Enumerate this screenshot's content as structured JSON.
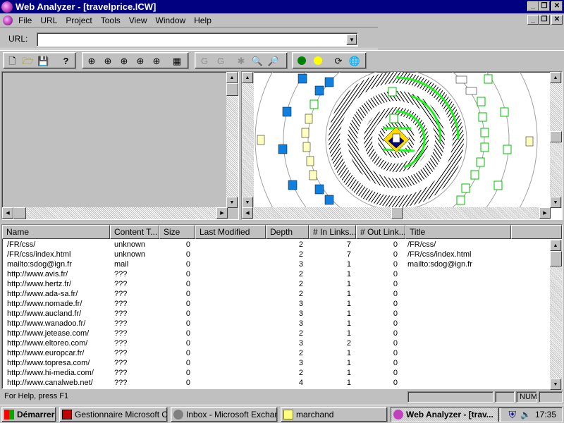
{
  "window": {
    "title": "Web Analyzer - [travelprice.ICW]"
  },
  "menu": [
    "File",
    "URL",
    "Project",
    "Tools",
    "View",
    "Window",
    "Help"
  ],
  "urlbar": {
    "label": "URL:",
    "value": ""
  },
  "list": {
    "columns": [
      "Name",
      "Content T...",
      "Size",
      "Last Modified",
      "Depth",
      "# In Links...",
      "# Out Link...",
      "Title"
    ],
    "rows": [
      [
        "/FR/css/",
        "unknown",
        "0",
        "",
        "2",
        "7",
        "0",
        "/FR/css/"
      ],
      [
        "/FR/css/index.html",
        "unknown",
        "0",
        "",
        "2",
        "7",
        "0",
        "/FR/css/index.html"
      ],
      [
        "mailto:sdog@ign.fr",
        "mail",
        "0",
        "",
        "3",
        "1",
        "0",
        "mailto:sdog@ign.fr"
      ],
      [
        "http://www.avis.fr/",
        "???",
        "0",
        "",
        "2",
        "1",
        "0",
        ""
      ],
      [
        "http://www.hertz.fr/",
        "???",
        "0",
        "",
        "2",
        "1",
        "0",
        ""
      ],
      [
        "http://www.ada-sa.fr/",
        "???",
        "0",
        "",
        "2",
        "1",
        "0",
        ""
      ],
      [
        "http://www.nomade.fr/",
        "???",
        "0",
        "",
        "3",
        "1",
        "0",
        ""
      ],
      [
        "http://www.aucland.fr/",
        "???",
        "0",
        "",
        "3",
        "1",
        "0",
        ""
      ],
      [
        "http://www.wanadoo.fr/",
        "???",
        "0",
        "",
        "3",
        "1",
        "0",
        ""
      ],
      [
        "http://www.jetease.com/",
        "???",
        "0",
        "",
        "2",
        "1",
        "0",
        ""
      ],
      [
        "http://www.eltoreo.com/",
        "???",
        "0",
        "",
        "3",
        "2",
        "0",
        ""
      ],
      [
        "http://www.europcar.fr/",
        "???",
        "0",
        "",
        "2",
        "1",
        "0",
        ""
      ],
      [
        "http://www.topresa.com/",
        "???",
        "0",
        "",
        "3",
        "1",
        "0",
        ""
      ],
      [
        "http://www.hi-media.com/",
        "???",
        "0",
        "",
        "2",
        "1",
        "0",
        ""
      ],
      [
        "http://www.canalweb.net/",
        "???",
        "0",
        "",
        "4",
        "1",
        "0",
        ""
      ]
    ]
  },
  "status": {
    "help": "For Help, press F1",
    "num": "NUM"
  },
  "taskbar": {
    "start": "Démarrer",
    "tasks": [
      "Gestionnaire Microsoft Of...",
      "Inbox - Microsoft Exchange",
      "marchand",
      "Web Analyzer - [trav..."
    ],
    "clock": "17:35"
  },
  "colors": {
    "title_bg": "#000080",
    "face": "#c0c0c0",
    "ring_green": "#00ff00"
  }
}
